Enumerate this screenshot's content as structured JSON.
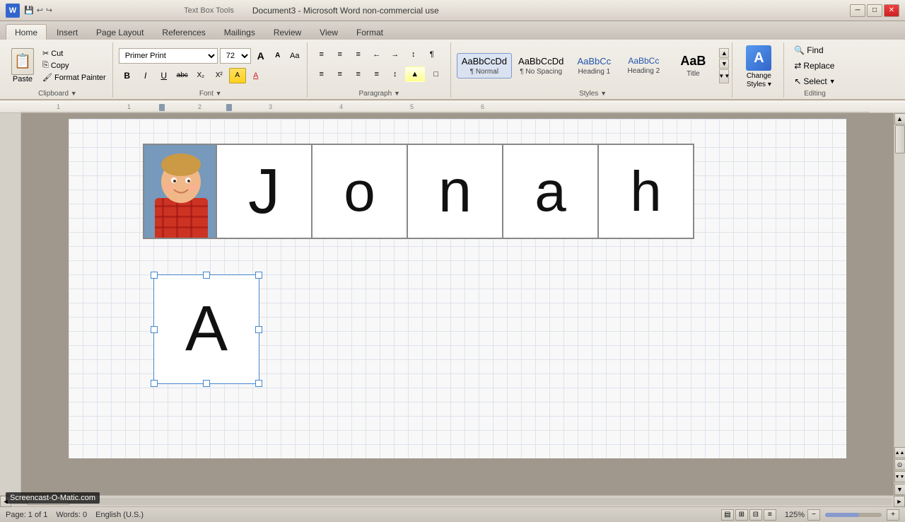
{
  "titleBar": {
    "contextLabel": "Text Box Tools",
    "docTitle": "Document3 - Microsoft Word non-commercial use",
    "minBtn": "─",
    "maxBtn": "□",
    "closeBtn": "✕"
  },
  "ribbon": {
    "tabs": [
      {
        "label": "Home",
        "active": true
      },
      {
        "label": "Insert",
        "active": false
      },
      {
        "label": "Page Layout",
        "active": false
      },
      {
        "label": "References",
        "active": false
      },
      {
        "label": "Mailings",
        "active": false
      },
      {
        "label": "Review",
        "active": false
      },
      {
        "label": "View",
        "active": false
      },
      {
        "label": "Format",
        "active": false
      }
    ],
    "clipboard": {
      "pasteLabel": "Paste",
      "cutLabel": "Cut",
      "copyLabel": "Copy",
      "formatPainterLabel": "Format Painter"
    },
    "font": {
      "fontName": "Primer Print",
      "fontSize": "72",
      "growLabel": "A",
      "shrinkLabel": "A",
      "clearLabel": "Aa",
      "boldLabel": "B",
      "italicLabel": "I",
      "underlineLabel": "U",
      "strikeLabel": "abc",
      "subLabel": "X₂",
      "supLabel": "X²",
      "colorLabel": "A"
    },
    "paragraph": {
      "bulletLabel": "≡",
      "numberedLabel": "≡",
      "indentDecLabel": "←",
      "indentIncLabel": "→",
      "sortLabel": "↕",
      "showHideLabel": "¶",
      "alignLeftLabel": "≡",
      "alignCenterLabel": "≡",
      "alignRightLabel": "≡",
      "justifyLabel": "≡",
      "lineSpacLabel": "↕",
      "shadingLabel": "▲",
      "bordersLabel": "□"
    },
    "styles": {
      "items": [
        {
          "id": "normal",
          "preview": "AaBbCcDd",
          "label": "¶ Normal",
          "selected": true
        },
        {
          "id": "no-spacing",
          "preview": "AaBbCcDd",
          "label": "¶ No Spacing",
          "selected": false
        },
        {
          "id": "heading1",
          "preview": "AaBbCc",
          "label": "Heading 1",
          "selected": false
        },
        {
          "id": "heading2",
          "preview": "AaBbCc",
          "label": "Heading 2",
          "selected": false
        },
        {
          "id": "title",
          "preview": "AaB",
          "label": "Title",
          "selected": false
        }
      ],
      "changeStylesLabel": "Change\nStyles"
    },
    "editing": {
      "findLabel": "Find",
      "replaceLabel": "Replace",
      "selectLabel": "Select"
    }
  },
  "document": {
    "nameLetters": [
      "J",
      "o",
      "n",
      "a",
      "h"
    ],
    "selectedLetter": "A",
    "zoom": "125%"
  },
  "statusBar": {
    "pageInfo": "Page: 1 of 1",
    "wordCount": "Words: 0",
    "language": "English (U.S.)"
  },
  "watermark": "Screencast-O-Matic.com"
}
